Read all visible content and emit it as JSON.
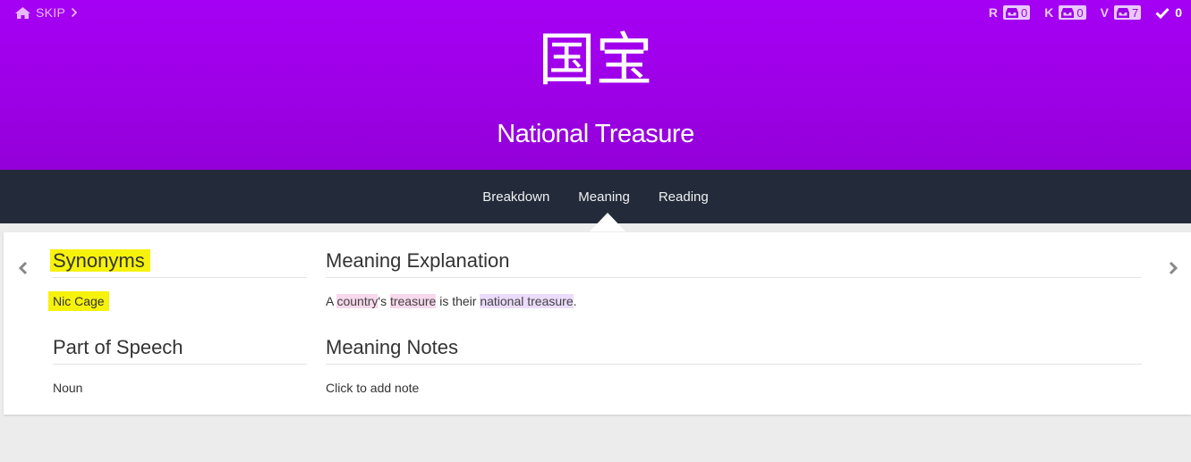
{
  "header": {
    "skip_label": "SKIP",
    "characters": "国宝",
    "meaning": "National Treasure",
    "colors": {
      "background": "#a000ee",
      "accent_box": "#e9c8ff"
    },
    "stats": [
      {
        "letter": "R",
        "value": "0"
      },
      {
        "letter": "K",
        "value": "0"
      },
      {
        "letter": "V",
        "value": "7"
      }
    ],
    "correct_count": "0"
  },
  "nav": {
    "tabs": [
      {
        "label": "Breakdown"
      },
      {
        "label": "Meaning"
      },
      {
        "label": "Reading"
      }
    ],
    "active_tab": "Meaning"
  },
  "card": {
    "synonyms": {
      "title": "Synonyms",
      "value": "Nic Cage"
    },
    "part_of_speech": {
      "title": "Part of Speech",
      "value": "Noun"
    },
    "meaning_explanation": {
      "title": "Meaning Explanation",
      "parts": [
        "A ",
        "country",
        "'s ",
        "treasure",
        " is their ",
        "national treasure",
        "."
      ]
    },
    "meaning_notes": {
      "title": "Meaning Notes",
      "placeholder": "Click to add note"
    }
  }
}
